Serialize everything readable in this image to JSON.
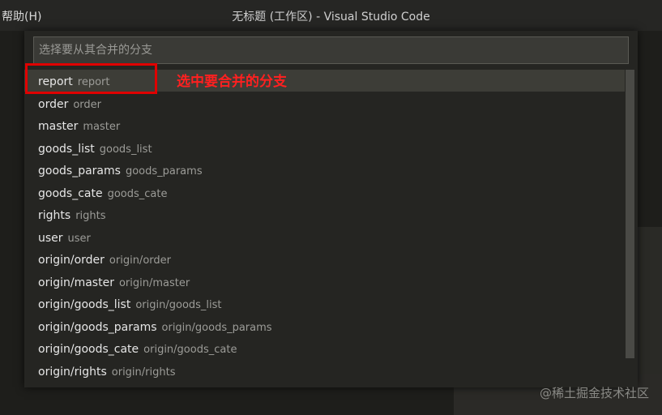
{
  "titlebar": {
    "menu_help": "帮助(H)",
    "window_title": "无标题 (工作区) - Visual Studio Code"
  },
  "quick_pick": {
    "placeholder": "选择要从其合并的分支",
    "items": [
      {
        "label": "report",
        "desc": "report"
      },
      {
        "label": "order",
        "desc": "order"
      },
      {
        "label": "master",
        "desc": "master"
      },
      {
        "label": "goods_list",
        "desc": "goods_list"
      },
      {
        "label": "goods_params",
        "desc": "goods_params"
      },
      {
        "label": "goods_cate",
        "desc": "goods_cate"
      },
      {
        "label": "rights",
        "desc": "rights"
      },
      {
        "label": "user",
        "desc": "user"
      },
      {
        "label": "origin/order",
        "desc": "origin/order"
      },
      {
        "label": "origin/master",
        "desc": "origin/master"
      },
      {
        "label": "origin/goods_list",
        "desc": "origin/goods_list"
      },
      {
        "label": "origin/goods_params",
        "desc": "origin/goods_params"
      },
      {
        "label": "origin/goods_cate",
        "desc": "origin/goods_cate"
      },
      {
        "label": "origin/rights",
        "desc": "origin/rights"
      }
    ]
  },
  "annotation": {
    "text": "选中要合并的分支",
    "color": "#ff2020"
  },
  "watermark": "@稀土掘金技术社区"
}
